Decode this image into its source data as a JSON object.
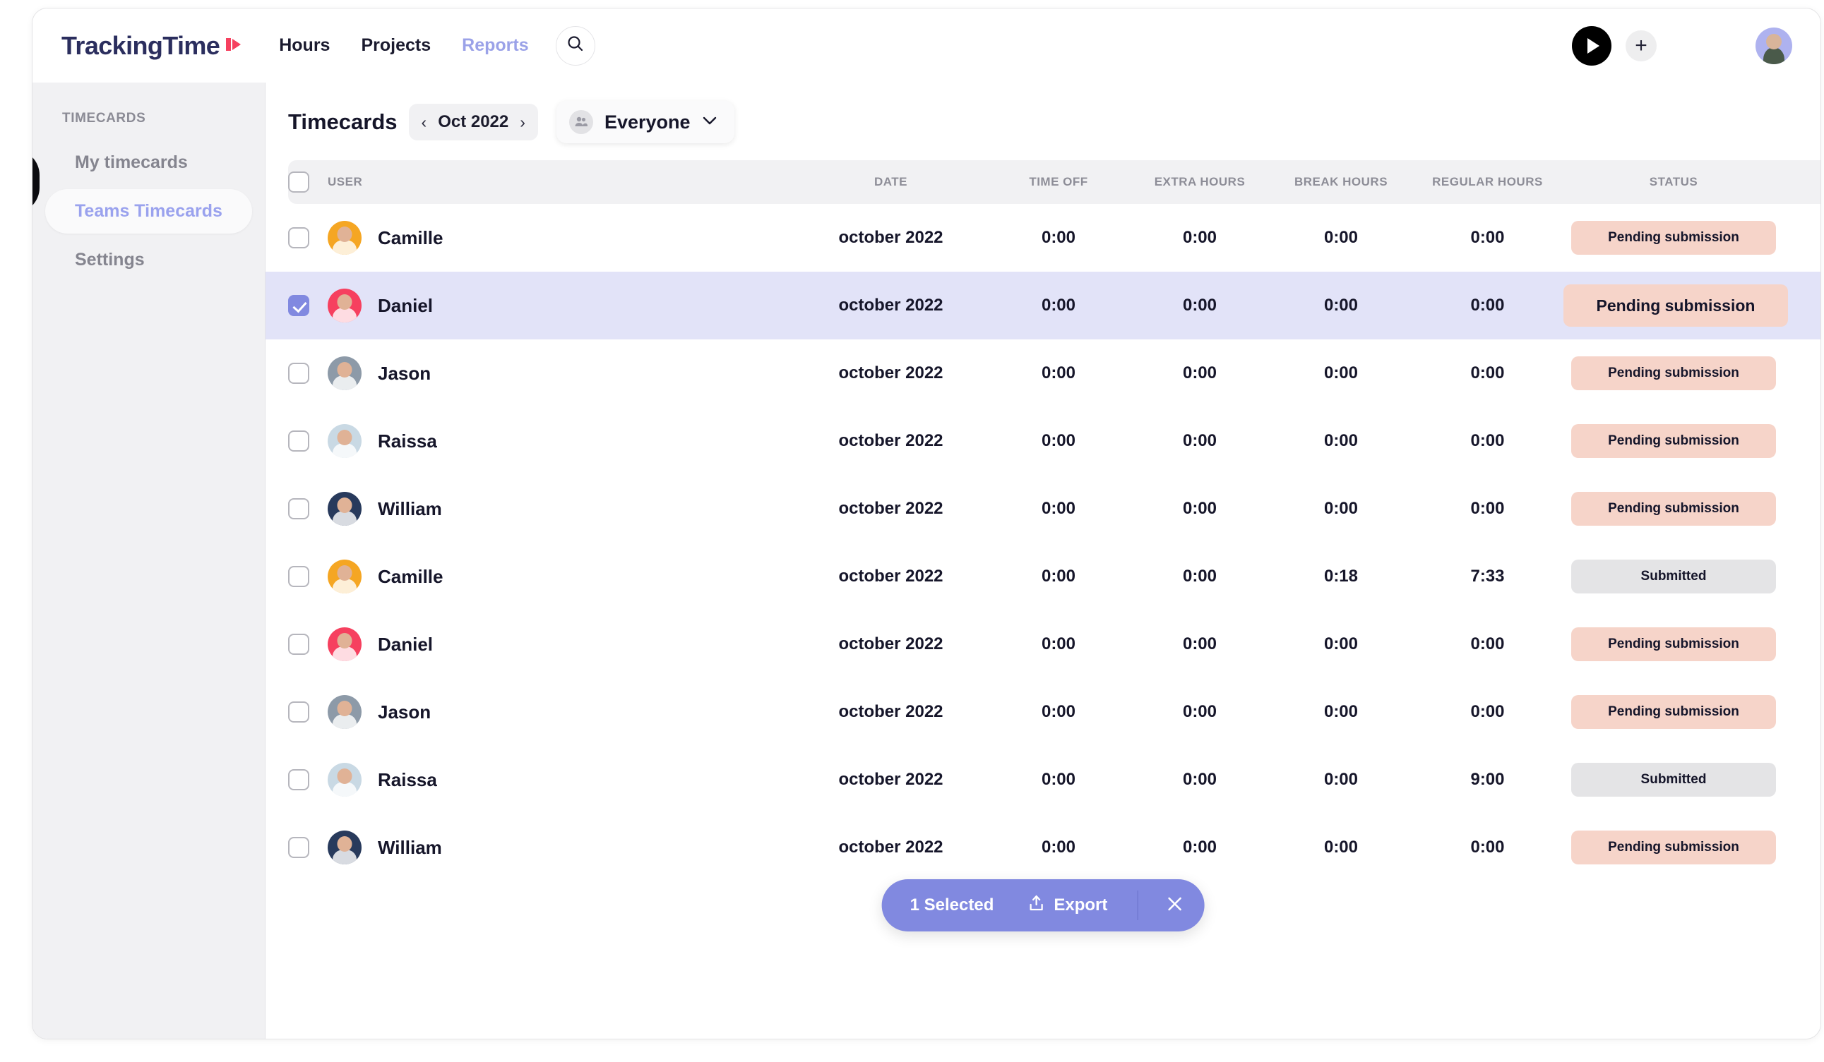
{
  "brand": {
    "name": "TrackingTime",
    "mark": "play-mark"
  },
  "topnav": {
    "links": [
      {
        "label": "Hours",
        "active": true
      },
      {
        "label": "Projects",
        "active": true
      },
      {
        "label": "Reports",
        "active": false
      }
    ],
    "search_icon": "search-icon",
    "play_icon": "play-icon",
    "add_icon": "plus-icon",
    "avatar": "user-avatar"
  },
  "sidebar": {
    "section_label": "TIMECARDS",
    "items": [
      {
        "label": "My timecards",
        "active": false
      },
      {
        "label": "Teams Timecards",
        "active": true
      },
      {
        "label": "Settings",
        "active": false
      }
    ],
    "collapse_handle": "collapse-handle"
  },
  "toolbar": {
    "title": "Timecards",
    "prev_icon": "chevron-left-icon",
    "month": "Oct 2022",
    "next_icon": "chevron-right-icon",
    "filter": {
      "icon": "people-icon",
      "label": "Everyone",
      "caret": "chevron-down-icon"
    }
  },
  "table": {
    "columns": [
      "USER",
      "DATE",
      "TIME OFF",
      "EXTRA HOURS",
      "BREAK HOURS",
      "REGULAR HOURS",
      "STATUS"
    ],
    "rows": [
      {
        "selected": false,
        "user": "Camille",
        "avatar_color": "#f5a623",
        "date": "october 2022",
        "time_off": "0:00",
        "extra_hours": "0:00",
        "break_hours": "0:00",
        "regular_hours": "0:00",
        "status": "Pending submission",
        "status_kind": "pending"
      },
      {
        "selected": true,
        "user": "Daniel",
        "avatar_color": "#f6405f",
        "date": "october 2022",
        "time_off": "0:00",
        "extra_hours": "0:00",
        "break_hours": "0:00",
        "regular_hours": "0:00",
        "status": "Pending submission",
        "status_kind": "pending"
      },
      {
        "selected": false,
        "user": "Jason",
        "avatar_color": "#8d9aa8",
        "date": "october 2022",
        "time_off": "0:00",
        "extra_hours": "0:00",
        "break_hours": "0:00",
        "regular_hours": "0:00",
        "status": "Pending submission",
        "status_kind": "pending"
      },
      {
        "selected": false,
        "user": "Raissa",
        "avatar_color": "#c9d9e4",
        "date": "october 2022",
        "time_off": "0:00",
        "extra_hours": "0:00",
        "break_hours": "0:00",
        "regular_hours": "0:00",
        "status": "Pending submission",
        "status_kind": "pending"
      },
      {
        "selected": false,
        "user": "William",
        "avatar_color": "#283a5c",
        "date": "october 2022",
        "time_off": "0:00",
        "extra_hours": "0:00",
        "break_hours": "0:00",
        "regular_hours": "0:00",
        "status": "Pending submission",
        "status_kind": "pending"
      },
      {
        "selected": false,
        "user": "Camille",
        "avatar_color": "#f5a623",
        "date": "october 2022",
        "time_off": "0:00",
        "extra_hours": "0:00",
        "break_hours": "0:18",
        "regular_hours": "7:33",
        "status": "Submitted",
        "status_kind": "submitted"
      },
      {
        "selected": false,
        "user": "Daniel",
        "avatar_color": "#f6405f",
        "date": "october 2022",
        "time_off": "0:00",
        "extra_hours": "0:00",
        "break_hours": "0:00",
        "regular_hours": "0:00",
        "status": "Pending submission",
        "status_kind": "pending"
      },
      {
        "selected": false,
        "user": "Jason",
        "avatar_color": "#8d9aa8",
        "date": "october 2022",
        "time_off": "0:00",
        "extra_hours": "0:00",
        "break_hours": "0:00",
        "regular_hours": "0:00",
        "status": "Pending submission",
        "status_kind": "pending"
      },
      {
        "selected": false,
        "user": "Raissa",
        "avatar_color": "#c9d9e4",
        "date": "october 2022",
        "time_off": "0:00",
        "extra_hours": "0:00",
        "break_hours": "0:00",
        "regular_hours": "9:00",
        "status": "Submitted",
        "status_kind": "submitted"
      },
      {
        "selected": false,
        "user": "William",
        "avatar_color": "#283a5c",
        "date": "october 2022",
        "time_off": "0:00",
        "extra_hours": "0:00",
        "break_hours": "0:00",
        "regular_hours": "0:00",
        "status": "Pending submission",
        "status_kind": "pending"
      }
    ]
  },
  "actionbar": {
    "count_label": "1 Selected",
    "export_label": "Export",
    "export_icon": "upload-icon",
    "close_icon": "close-icon"
  },
  "colors": {
    "accent": "#8189e0",
    "pending_badge": "#f6d4c9",
    "submitted_badge": "#e4e4e6",
    "selected_row": "#e2e3f8",
    "sidebar_bg": "#f1f1f3",
    "brand_navy": "#2b2e5e",
    "brand_red": "#f6405f"
  }
}
